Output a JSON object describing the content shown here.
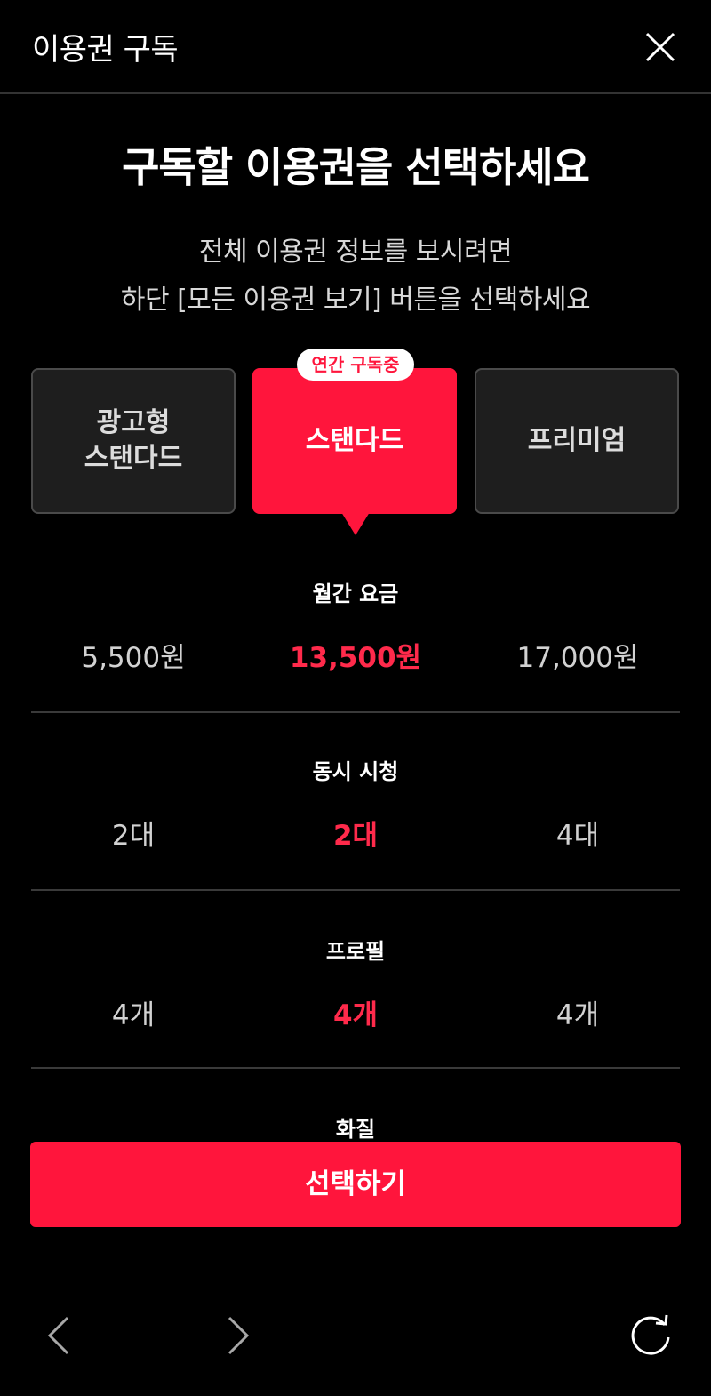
{
  "header": {
    "title": "이용권 구독"
  },
  "headline": "구독할 이용권을 선택하세요",
  "subtitle": {
    "line1": "전체 이용권 정보를 보시려면",
    "line2": "하단 [모든 이용권 보기] 버튼을 선택하세요"
  },
  "plans": [
    {
      "label": "광고형\n스탠다드",
      "selected": false
    },
    {
      "label": "스탠다드",
      "selected": true,
      "badge": "연간 구독중"
    },
    {
      "label": "프리미엄",
      "selected": false
    }
  ],
  "rows": [
    {
      "label": "월간 요금",
      "values": [
        "5,500원",
        "13,500원",
        "17,000원"
      ]
    },
    {
      "label": "동시 시청",
      "values": [
        "2대",
        "2대",
        "4대"
      ]
    },
    {
      "label": "프로필",
      "values": [
        "4개",
        "4개",
        "4개"
      ]
    },
    {
      "label": "화질"
    }
  ],
  "cta_label": "선택하기",
  "colors": {
    "accent": "#ff153c",
    "background": "#000000",
    "card": "#1e1e1e"
  },
  "icons": {
    "close": "close-icon",
    "back": "chevron-left-icon",
    "forward": "chevron-right-icon",
    "refresh": "refresh-icon"
  }
}
